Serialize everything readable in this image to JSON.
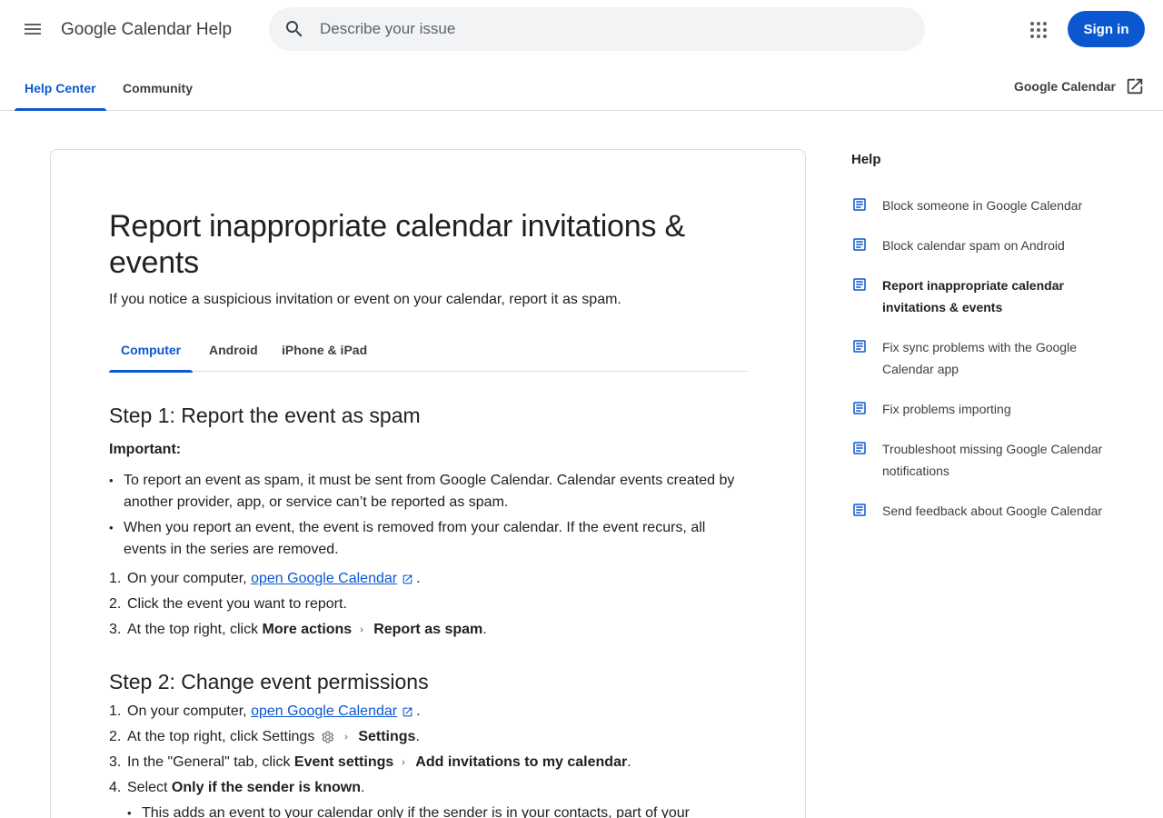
{
  "header": {
    "site_title": "Google Calendar Help",
    "search_placeholder": "Describe your issue",
    "sign_in": "Sign in"
  },
  "nav": {
    "tabs": [
      {
        "label": "Help Center",
        "active": true
      },
      {
        "label": "Community",
        "active": false
      }
    ],
    "product_link": "Google Calendar"
  },
  "article": {
    "title": "Report inappropriate calendar invitations & events",
    "intro": "If you notice a suspicious invitation or event on your calendar, report it as spam.",
    "platform_tabs": [
      "Computer",
      "Android",
      "iPhone & iPad"
    ],
    "step1": {
      "heading": "Step 1: Report the event as spam",
      "important_label": "Important:",
      "bullets": [
        "To report an event as spam, it must be sent from Google Calendar. Calendar events created by another provider, app, or service can’t be reported as spam.",
        "When you report an event, the event is removed from your calendar. If the event recurs, all events in the series are removed."
      ],
      "s1_prefix": "On your computer, ",
      "s1_link": "open Google Calendar",
      "s1_suffix": ".",
      "s2": "Click the event you want to report.",
      "s3_prefix": "At the top right, click ",
      "s3_b1": "More actions",
      "s3_b2": "Report as spam",
      "s3_suffix": "."
    },
    "step2": {
      "heading": "Step 2: Change event permissions",
      "s1_prefix": "On your computer, ",
      "s1_link": "open Google Calendar",
      "s1_suffix": ".",
      "s2_prefix": "At the top right, click Settings",
      "s2_b": "Settings",
      "s2_suffix": ".",
      "s3_prefix": "In the \"General\" tab, click ",
      "s3_b1": "Event settings",
      "s3_b2": "Add invitations to my calendar",
      "s3_suffix": ".",
      "s4_prefix": "Select ",
      "s4_b": "Only if the sender is known",
      "s4_suffix": ".",
      "s4_sub": "This adds an event to your calendar only if the sender is in your contacts, part of your"
    },
    "numbers": [
      "1.",
      "2.",
      "3.",
      "4."
    ]
  },
  "sidebar": {
    "title": "Help",
    "items": [
      "Block someone in Google Calendar",
      "Block calendar spam on Android",
      "Report inappropriate calendar invitations & events",
      "Fix sync problems with the Google Calendar app",
      "Fix problems importing",
      "Troubleshoot missing Google Calendar notifications",
      "Send feedback about Google Calendar"
    ],
    "current_index": 2
  },
  "colors": {
    "accent": "#0b57d0",
    "text": "#202124",
    "muted": "#3c4043",
    "search_bg": "#f1f3f4",
    "border": "#dadce0",
    "doc_icon": "#0b57d0"
  }
}
